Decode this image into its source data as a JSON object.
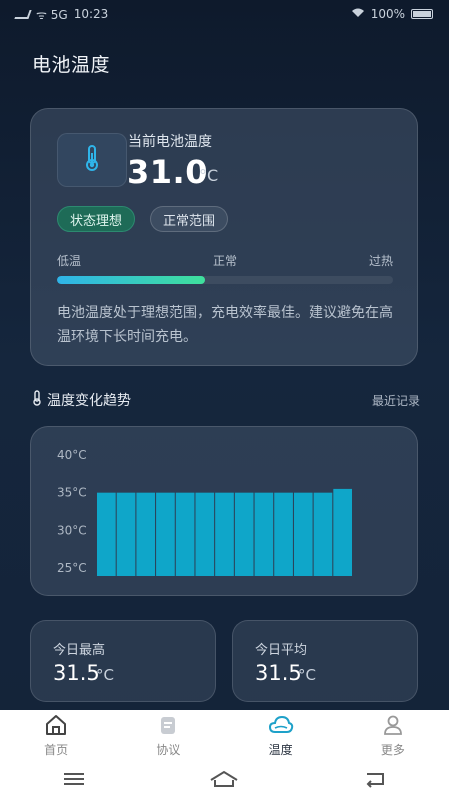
{
  "status_bar": {
    "left_text": "ᯤ 5G",
    "time": "10:23",
    "battery": "100%"
  },
  "page": {
    "title": "电池温度"
  },
  "current": {
    "label": "当前电池温度",
    "value": "31.0",
    "unit": "°C",
    "icon": "thermometer-icon"
  },
  "badges": {
    "status": "状态理想",
    "range": "正常范围"
  },
  "scale": {
    "low": "低温",
    "normal": "正常",
    "high": "过热",
    "level_fraction": 0.44
  },
  "description": "电池温度处于理想范围，充电效率最佳。建议避免在高温环境下长时间充电。",
  "trend": {
    "title": "温度变化趋势",
    "link": "最近记录",
    "icon": "thermometer-icon"
  },
  "chart_data": {
    "type": "area",
    "y_ticks": [
      "40°C",
      "35°C",
      "30°C",
      "25°C"
    ],
    "ylim": [
      25,
      40
    ],
    "values": [
      35,
      35,
      35,
      35,
      35,
      35,
      35,
      35,
      35,
      35,
      35,
      35,
      35.5
    ],
    "color": "#0fa6c9"
  },
  "stats": {
    "high": {
      "label": "今日最高",
      "value": "31.5",
      "unit": "°C"
    },
    "avg": {
      "label": "今日平均",
      "value": "31.5",
      "unit": "°C"
    }
  },
  "tabs": [
    {
      "label": "首页",
      "icon": "home-icon"
    },
    {
      "label": "协议",
      "icon": "document-icon"
    },
    {
      "label": "温度",
      "icon": "cloud-icon"
    },
    {
      "label": "更多",
      "icon": "user-icon"
    }
  ],
  "active_tab": "温度",
  "colors": {
    "accent": "#2fb4e9",
    "good": "#1e6b57",
    "gauge_end": "#3fe09c"
  }
}
